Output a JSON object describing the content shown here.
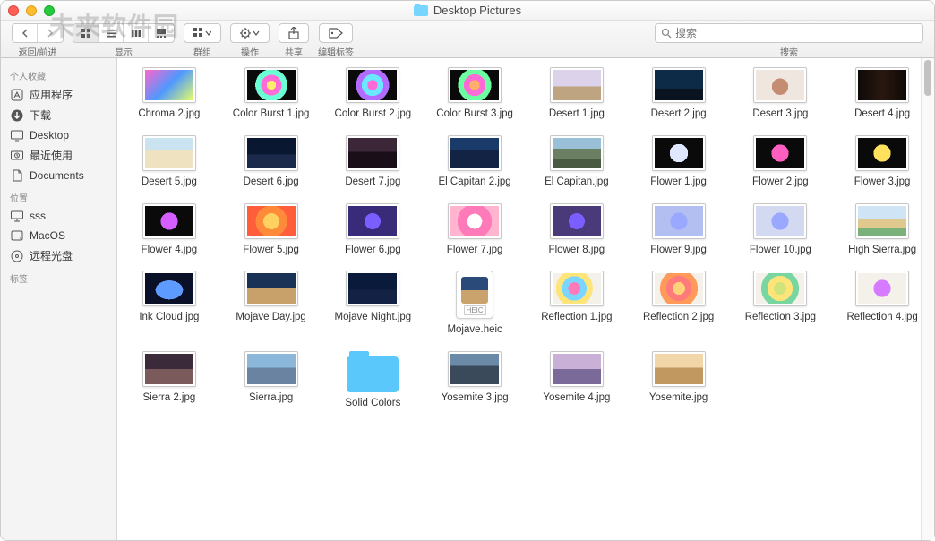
{
  "window": {
    "title": "Desktop Pictures"
  },
  "toolbar": {
    "nav_label": "返回/前进",
    "view_label": "显示",
    "group_label": "群组",
    "action_label": "操作",
    "share_label": "共享",
    "edit_tags_label": "编辑标签",
    "search_label": "搜索",
    "search_placeholder": "搜索"
  },
  "watermark": "未来软件园",
  "sidebar": {
    "sections": [
      {
        "title": "个人收藏",
        "items": [
          {
            "icon": "app",
            "label": "应用程序"
          },
          {
            "icon": "download",
            "label": "下载"
          },
          {
            "icon": "desktop",
            "label": "Desktop"
          },
          {
            "icon": "recent",
            "label": "最近使用"
          },
          {
            "icon": "docs",
            "label": "Documents"
          }
        ]
      },
      {
        "title": "位置",
        "items": [
          {
            "icon": "monitor",
            "label": "sss"
          },
          {
            "icon": "disk",
            "label": "MacOS"
          },
          {
            "icon": "disc",
            "label": "远程光盘"
          }
        ]
      },
      {
        "title": "标签",
        "items": []
      }
    ]
  },
  "files": [
    {
      "name": "Chroma 2.jpg",
      "bg": "linear-gradient(135deg,#ff66cc,#4f98ff,#e6ff66)"
    },
    {
      "name": "Color Burst 1.jpg",
      "bg": "radial-gradient(circle at 50% 50%,#ffec6b 0 16%,#ff6bd6 16% 36%,#6bffd6 36% 56%,#0a0a0a 56%)"
    },
    {
      "name": "Color Burst 2.jpg",
      "bg": "radial-gradient(circle at 50% 50%,#ff6bd6 0 18%,#6be7ff 18% 38%,#b36bff 38% 58%,#0a0a0a 58%)"
    },
    {
      "name": "Color Burst 3.jpg",
      "bg": "radial-gradient(circle at 50% 50%,#ffae6b 0 18%,#ff6bd6 18% 38%,#6bffa1 38% 58%,#0a0a0a 58%)"
    },
    {
      "name": "Desert 1.jpg",
      "bg": "linear-gradient(#dcd2ea 0 55%,#bfa481 55%)"
    },
    {
      "name": "Desert 2.jpg",
      "bg": "linear-gradient(#0d2a47 0 62%,#0a1320 62%)"
    },
    {
      "name": "Desert 3.jpg",
      "bg": "radial-gradient(circle at 50% 55%,#c58c74 0 28%,#efe6df 28%)"
    },
    {
      "name": "Desert 4.jpg",
      "bg": "linear-gradient(90deg,#0e0a08,#2a1810,#0e0a08)"
    },
    {
      "name": "Desert 5.jpg",
      "bg": "linear-gradient(#c9e4f0 0 38%,#efe2c0 38%)"
    },
    {
      "name": "Desert 6.jpg",
      "bg": "linear-gradient(#0a1730 0 55%,#1b2a4a 55%)"
    },
    {
      "name": "Desert 7.jpg",
      "bg": "linear-gradient(#3b2738 0 45%,#1a0f18 45%)"
    },
    {
      "name": "El Capitan 2.jpg",
      "bg": "linear-gradient(#1a3a6a 0 40%,#122344 40%)"
    },
    {
      "name": "El Capitan.jpg",
      "bg": "linear-gradient(#99c0d6 0 35%,#6b7f63 35% 70%,#4a5a42 70%)"
    },
    {
      "name": "Flower 1.jpg",
      "bg": "radial-gradient(circle at 50% 50%,#dfe8ff 0 32%,#0a0a0a 32%)"
    },
    {
      "name": "Flower 2.jpg",
      "bg": "radial-gradient(circle at 50% 50%,#ff5ec1 0 30%,#0a0a0a 30%)"
    },
    {
      "name": "Flower 3.jpg",
      "bg": "radial-gradient(circle at 50% 50%,#ffe15e 0 30%,#0a0a0a 30%)"
    },
    {
      "name": "Flower 4.jpg",
      "bg": "radial-gradient(circle at 50% 50%,#d45eff 0 30%,#0a0a0a 30%)"
    },
    {
      "name": "Flower 5.jpg",
      "bg": "radial-gradient(circle at 50% 50%,#ffd15e 0 28%,#ff8a3a 28% 55%,#ff5e3a 55%)"
    },
    {
      "name": "Flower 6.jpg",
      "bg": "radial-gradient(circle at 50% 50%,#7a5eff 0 28%,#3a2a7a 28%)"
    },
    {
      "name": "Flower 7.jpg",
      "bg": "radial-gradient(circle at 50% 50%,#ffffff 0 26%,#ff7ab8 26% 60%,#ffb4d0 60%)"
    },
    {
      "name": "Flower 8.jpg",
      "bg": "radial-gradient(circle at 50% 50%,#7a5eff 0 28%,#4a3a7a 28%)"
    },
    {
      "name": "Flower 9.jpg",
      "bg": "radial-gradient(circle at 50% 50%,#9aa8ff 0 30%,#b3bff0 30%)"
    },
    {
      "name": "Flower 10.jpg",
      "bg": "radial-gradient(circle at 50% 50%,#9aa8ff 0 30%,#d3d9f0 30%)"
    },
    {
      "name": "High Sierra.jpg",
      "bg": "linear-gradient(#cfe4f4 0 42%,#e0c98e 42% 72%,#7ab07a 72%)"
    },
    {
      "name": "Ink Cloud.jpg",
      "bg": "radial-gradient(ellipse at 50% 55%,#5e9bff 0 40%,#0a1028 40%)"
    },
    {
      "name": "Mojave Day.jpg",
      "bg": "linear-gradient(#1a3256 0 50%,#c7a06a 50%)"
    },
    {
      "name": "Mojave Night.jpg",
      "bg": "linear-gradient(#0a1a3a 0 55%,#132244 55%)"
    },
    {
      "name": "Mojave.heic",
      "type": "heic",
      "bg": "linear-gradient(#2a4a7a 0 50%,#caa26c 50%)",
      "tag": "HEIC"
    },
    {
      "name": "Reflection 1.jpg",
      "bg": "radial-gradient(circle at 45% 50%,#ff7ab8 0 20%,#7ad6ff 20% 40%,#ffe47a 40% 60%,#f4f0ea 60%)"
    },
    {
      "name": "Reflection 2.jpg",
      "bg": "radial-gradient(circle at 50% 50%,#ffd27a 0 22%,#ff7a7a 22% 44%,#ff9a5a 44% 66%,#f4f0ea 66%)"
    },
    {
      "name": "Reflection 3.jpg",
      "bg": "radial-gradient(circle at 50% 50%,#cfe47a 0 22%,#ffe47a 22% 44%,#7ad6a1 44% 66%,#f4f0ea 66%)"
    },
    {
      "name": "Reflection 4.jpg",
      "bg": "radial-gradient(circle at 50% 50%,#d67aff 0 30%,#f4f0ea 30%)"
    },
    {
      "name": "Sierra 2.jpg",
      "bg": "linear-gradient(#3a2a3a 0 50%,#7a5a5a 50%)"
    },
    {
      "name": "Sierra.jpg",
      "bg": "linear-gradient(#8bb8da 0 45%,#6a83a0 45%)"
    },
    {
      "name": "Solid Colors",
      "type": "folder"
    },
    {
      "name": "Yosemite 3.jpg",
      "bg": "linear-gradient(#6a8aa8 0 40%,#3a4a5a 40%)"
    },
    {
      "name": "Yosemite 4.jpg",
      "bg": "linear-gradient(#c9b0d6 0 50%,#7a6a9a 50%)"
    },
    {
      "name": "Yosemite.jpg",
      "bg": "linear-gradient(#f0d6a8 0 45%,#c09860 45%)"
    }
  ]
}
